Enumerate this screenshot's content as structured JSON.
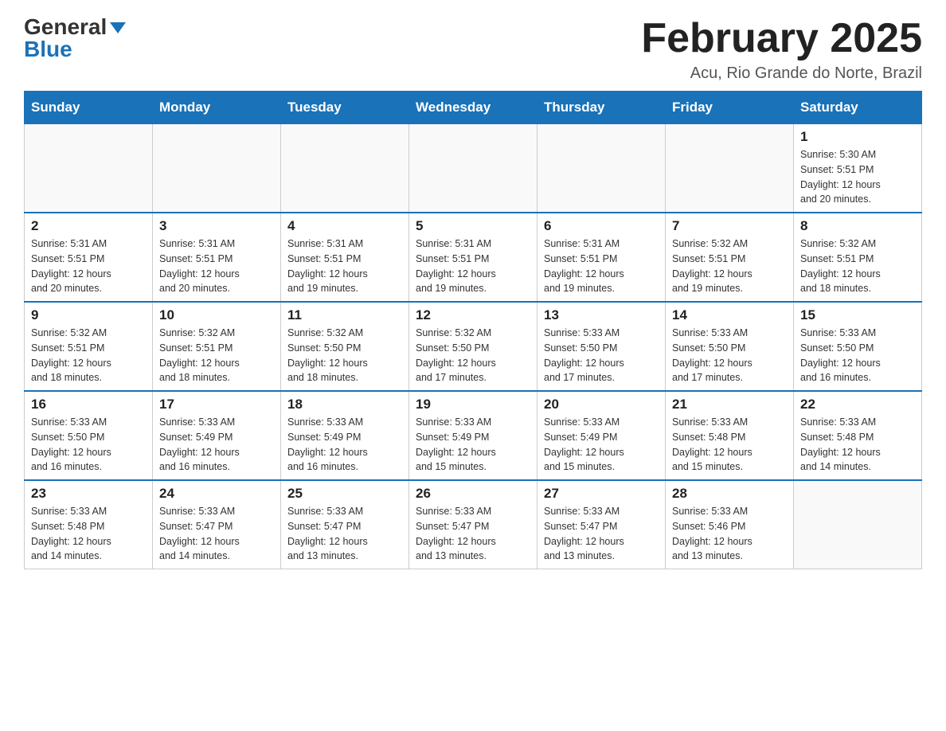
{
  "header": {
    "logo_general": "General",
    "logo_blue": "Blue",
    "month_title": "February 2025",
    "location": "Acu, Rio Grande do Norte, Brazil"
  },
  "days_of_week": [
    "Sunday",
    "Monday",
    "Tuesday",
    "Wednesday",
    "Thursday",
    "Friday",
    "Saturday"
  ],
  "weeks": [
    [
      {
        "day": "",
        "info": ""
      },
      {
        "day": "",
        "info": ""
      },
      {
        "day": "",
        "info": ""
      },
      {
        "day": "",
        "info": ""
      },
      {
        "day": "",
        "info": ""
      },
      {
        "day": "",
        "info": ""
      },
      {
        "day": "1",
        "info": "Sunrise: 5:30 AM\nSunset: 5:51 PM\nDaylight: 12 hours\nand 20 minutes."
      }
    ],
    [
      {
        "day": "2",
        "info": "Sunrise: 5:31 AM\nSunset: 5:51 PM\nDaylight: 12 hours\nand 20 minutes."
      },
      {
        "day": "3",
        "info": "Sunrise: 5:31 AM\nSunset: 5:51 PM\nDaylight: 12 hours\nand 20 minutes."
      },
      {
        "day": "4",
        "info": "Sunrise: 5:31 AM\nSunset: 5:51 PM\nDaylight: 12 hours\nand 19 minutes."
      },
      {
        "day": "5",
        "info": "Sunrise: 5:31 AM\nSunset: 5:51 PM\nDaylight: 12 hours\nand 19 minutes."
      },
      {
        "day": "6",
        "info": "Sunrise: 5:31 AM\nSunset: 5:51 PM\nDaylight: 12 hours\nand 19 minutes."
      },
      {
        "day": "7",
        "info": "Sunrise: 5:32 AM\nSunset: 5:51 PM\nDaylight: 12 hours\nand 19 minutes."
      },
      {
        "day": "8",
        "info": "Sunrise: 5:32 AM\nSunset: 5:51 PM\nDaylight: 12 hours\nand 18 minutes."
      }
    ],
    [
      {
        "day": "9",
        "info": "Sunrise: 5:32 AM\nSunset: 5:51 PM\nDaylight: 12 hours\nand 18 minutes."
      },
      {
        "day": "10",
        "info": "Sunrise: 5:32 AM\nSunset: 5:51 PM\nDaylight: 12 hours\nand 18 minutes."
      },
      {
        "day": "11",
        "info": "Sunrise: 5:32 AM\nSunset: 5:50 PM\nDaylight: 12 hours\nand 18 minutes."
      },
      {
        "day": "12",
        "info": "Sunrise: 5:32 AM\nSunset: 5:50 PM\nDaylight: 12 hours\nand 17 minutes."
      },
      {
        "day": "13",
        "info": "Sunrise: 5:33 AM\nSunset: 5:50 PM\nDaylight: 12 hours\nand 17 minutes."
      },
      {
        "day": "14",
        "info": "Sunrise: 5:33 AM\nSunset: 5:50 PM\nDaylight: 12 hours\nand 17 minutes."
      },
      {
        "day": "15",
        "info": "Sunrise: 5:33 AM\nSunset: 5:50 PM\nDaylight: 12 hours\nand 16 minutes."
      }
    ],
    [
      {
        "day": "16",
        "info": "Sunrise: 5:33 AM\nSunset: 5:50 PM\nDaylight: 12 hours\nand 16 minutes."
      },
      {
        "day": "17",
        "info": "Sunrise: 5:33 AM\nSunset: 5:49 PM\nDaylight: 12 hours\nand 16 minutes."
      },
      {
        "day": "18",
        "info": "Sunrise: 5:33 AM\nSunset: 5:49 PM\nDaylight: 12 hours\nand 16 minutes."
      },
      {
        "day": "19",
        "info": "Sunrise: 5:33 AM\nSunset: 5:49 PM\nDaylight: 12 hours\nand 15 minutes."
      },
      {
        "day": "20",
        "info": "Sunrise: 5:33 AM\nSunset: 5:49 PM\nDaylight: 12 hours\nand 15 minutes."
      },
      {
        "day": "21",
        "info": "Sunrise: 5:33 AM\nSunset: 5:48 PM\nDaylight: 12 hours\nand 15 minutes."
      },
      {
        "day": "22",
        "info": "Sunrise: 5:33 AM\nSunset: 5:48 PM\nDaylight: 12 hours\nand 14 minutes."
      }
    ],
    [
      {
        "day": "23",
        "info": "Sunrise: 5:33 AM\nSunset: 5:48 PM\nDaylight: 12 hours\nand 14 minutes."
      },
      {
        "day": "24",
        "info": "Sunrise: 5:33 AM\nSunset: 5:47 PM\nDaylight: 12 hours\nand 14 minutes."
      },
      {
        "day": "25",
        "info": "Sunrise: 5:33 AM\nSunset: 5:47 PM\nDaylight: 12 hours\nand 13 minutes."
      },
      {
        "day": "26",
        "info": "Sunrise: 5:33 AM\nSunset: 5:47 PM\nDaylight: 12 hours\nand 13 minutes."
      },
      {
        "day": "27",
        "info": "Sunrise: 5:33 AM\nSunset: 5:47 PM\nDaylight: 12 hours\nand 13 minutes."
      },
      {
        "day": "28",
        "info": "Sunrise: 5:33 AM\nSunset: 5:46 PM\nDaylight: 12 hours\nand 13 minutes."
      },
      {
        "day": "",
        "info": ""
      }
    ]
  ]
}
